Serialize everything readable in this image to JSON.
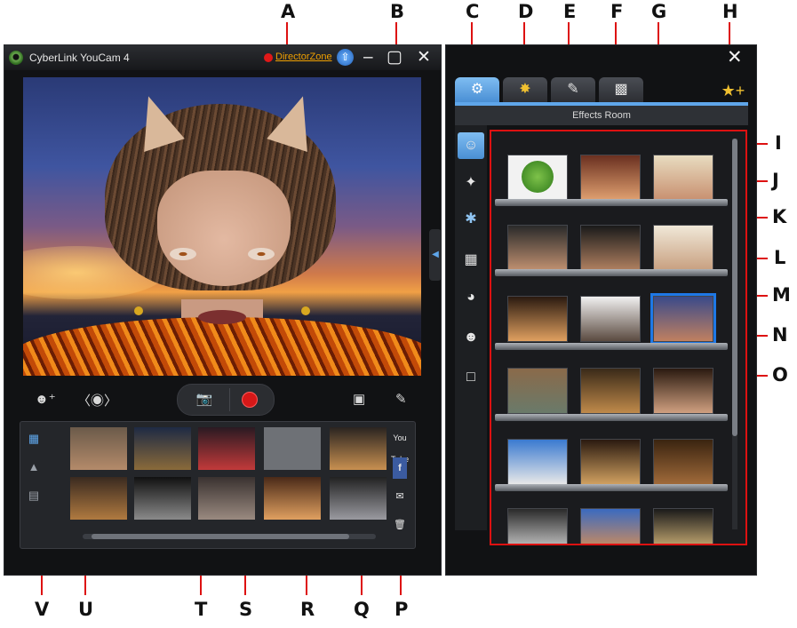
{
  "window": {
    "title": "CyberLink YouCam 4",
    "director_zone": "DirectorZone",
    "minimize": "–",
    "fullscreen": "▢",
    "close": "✕"
  },
  "effects_panel": {
    "room_label": "Effects Room",
    "close": "✕",
    "tabs": [
      "effects",
      "magic",
      "brush",
      "emotion"
    ]
  },
  "callouts": {
    "top": [
      "A",
      "B",
      "C",
      "D",
      "E",
      "F",
      "G",
      "H"
    ],
    "right": [
      "I",
      "J",
      "K",
      "L",
      "M",
      "N",
      "O"
    ],
    "bottom": [
      "V",
      "U",
      "T",
      "S",
      "R",
      "Q",
      "P"
    ]
  },
  "library": {
    "share": [
      "You Tube",
      "f",
      "✉",
      "🗑"
    ]
  },
  "colors": {
    "accent": "#4a8fd4",
    "callout_line": "#dd1111",
    "record": "#d61818"
  }
}
